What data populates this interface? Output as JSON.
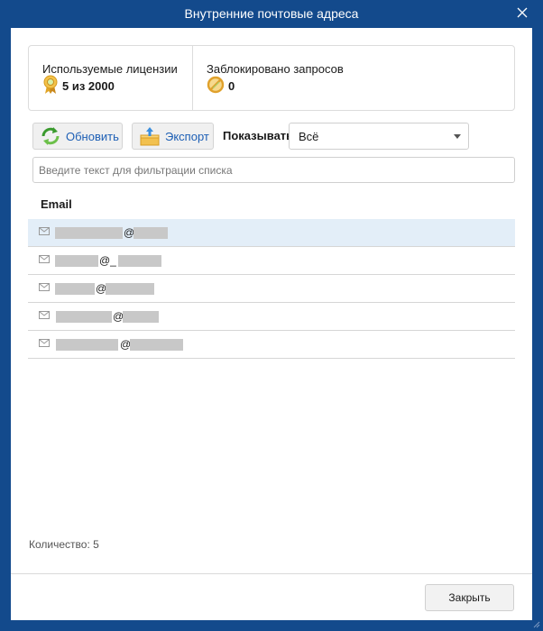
{
  "window": {
    "title": "Внутренние почтовые адреса"
  },
  "stats": {
    "licenses": {
      "label": "Используемые лицензии",
      "value": "5 из 2000",
      "icon": "ribbon-badge-icon"
    },
    "blocked": {
      "label": "Заблокировано запросов",
      "value": "0",
      "icon": "blocked-circle-icon"
    }
  },
  "toolbar": {
    "refresh_label": "Обновить",
    "export_label": "Экспорт",
    "show_label": "Показывать",
    "show_selected": "Всё"
  },
  "filter": {
    "placeholder": "Введите текст для фильтрации списка",
    "value": ""
  },
  "table": {
    "column_email": "Email",
    "rows": [
      {
        "at": "@",
        "selected": true
      },
      {
        "at": "@_",
        "selected": false
      },
      {
        "at": "@",
        "selected": false
      },
      {
        "at": "@",
        "selected": false
      },
      {
        "at": "@",
        "selected": false
      }
    ]
  },
  "footer": {
    "count_label": "Количество: 5",
    "close_label": "Закрыть"
  },
  "colors": {
    "titlebar": "#134a8c",
    "selected_row": "#e3eef8",
    "link_blue": "#1d5fb5"
  }
}
